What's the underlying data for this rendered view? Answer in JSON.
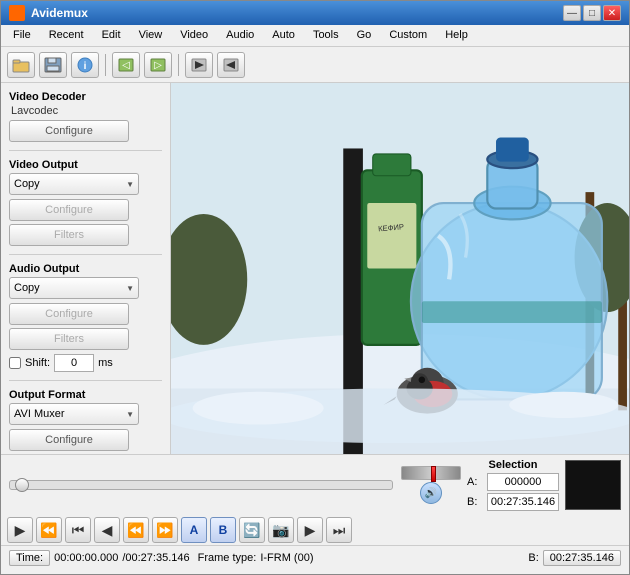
{
  "window": {
    "title": "Avidemux",
    "controls": {
      "minimize": "—",
      "maximize": "□",
      "close": "✕"
    }
  },
  "menu": {
    "items": [
      "File",
      "Recent",
      "Edit",
      "View",
      "Video",
      "Audio",
      "Auto",
      "Tools",
      "Go",
      "Custom",
      "Help"
    ]
  },
  "toolbar": {
    "buttons": [
      "open",
      "save",
      "info",
      "prev-segment",
      "next-segment",
      "properties",
      "play-forward",
      "play-backward"
    ]
  },
  "left_panel": {
    "video_decoder": {
      "title": "Video Decoder",
      "value": "Lavcodec",
      "configure_label": "Configure"
    },
    "video_output": {
      "title": "Video Output",
      "dropdown_value": "Copy",
      "configure_label": "Configure",
      "filters_label": "Filters"
    },
    "audio_output": {
      "title": "Audio Output",
      "dropdown_value": "Copy",
      "configure_label": "Configure",
      "filters_label": "Filters",
      "shift_label": "Shift:",
      "shift_value": "0",
      "shift_unit": "ms"
    },
    "output_format": {
      "title": "Output Format",
      "dropdown_value": "AVI Muxer",
      "configure_label": "Configure"
    }
  },
  "playback": {
    "time": {
      "label": "Time:",
      "current": "00:00:00.000",
      "total": "/00:27:35.146"
    },
    "frame_type": {
      "label": "Frame type:",
      "value": "I-FRM (00)"
    },
    "selection": {
      "title": "Selection",
      "a_label": "A:",
      "a_value": "000000",
      "b_label": "B:",
      "b_value": "00:27:35.146"
    }
  }
}
